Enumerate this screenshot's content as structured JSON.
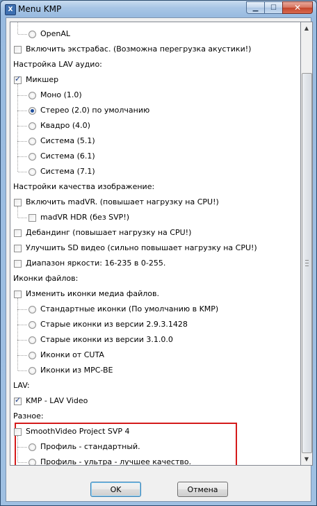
{
  "window": {
    "title": "Menu KMP",
    "icon_glyph": "X"
  },
  "options": [
    {
      "kind": "radio",
      "level": 2,
      "label": "OpenAL",
      "selected": false
    },
    {
      "kind": "checkbox",
      "level": 1,
      "label": "Включить экстрабас. (Возможна перегрузка акустики!)",
      "checked": false
    },
    {
      "kind": "heading",
      "level": 0,
      "label": "Настройка LAV аудио:"
    },
    {
      "kind": "checkbox",
      "level": 1,
      "label": "Микшер",
      "checked": true
    },
    {
      "kind": "radio",
      "level": 2,
      "label": "Моно (1.0)",
      "selected": false
    },
    {
      "kind": "radio",
      "level": 2,
      "label": "Стерео (2.0) по умолчанию",
      "selected": true
    },
    {
      "kind": "radio",
      "level": 2,
      "label": "Квадро (4.0)",
      "selected": false
    },
    {
      "kind": "radio",
      "level": 2,
      "label": "Система (5.1)",
      "selected": false
    },
    {
      "kind": "radio",
      "level": 2,
      "label": "Система (6.1)",
      "selected": false
    },
    {
      "kind": "radio",
      "level": 2,
      "label": "Система (7.1)",
      "selected": false
    },
    {
      "kind": "heading",
      "level": 0,
      "label": "Настройки качества изображение:"
    },
    {
      "kind": "checkbox",
      "level": 1,
      "label": "Включить madVR. (повышает нагрузку на CPU!)",
      "checked": false
    },
    {
      "kind": "checkbox",
      "level": 2,
      "label": "madVR HDR (без SVP!)",
      "checked": false
    },
    {
      "kind": "checkbox",
      "level": 1,
      "label": "Дебандинг (повышает нагрузку на CPU!)",
      "checked": false
    },
    {
      "kind": "checkbox",
      "level": 1,
      "label": "Улучшить SD видео (сильно повышает нагрузку на CPU!)",
      "checked": false
    },
    {
      "kind": "checkbox",
      "level": 1,
      "label": "Диапазон яркости: 16-235 в 0-255.",
      "checked": false
    },
    {
      "kind": "heading",
      "level": 0,
      "label": "Иконки файлов:"
    },
    {
      "kind": "checkbox",
      "level": 1,
      "label": "Изменить иконки медиа файлов.",
      "checked": false
    },
    {
      "kind": "radio",
      "level": 2,
      "label": "Стандартные иконки (По умолчанию в KMP)",
      "selected": false
    },
    {
      "kind": "radio",
      "level": 2,
      "label": "Старые иконки из версии 2.9.3.1428",
      "selected": false
    },
    {
      "kind": "radio",
      "level": 2,
      "label": "Старые иконки из версии 3.1.0.0",
      "selected": false
    },
    {
      "kind": "radio",
      "level": 2,
      "label": "Иконки от CUTA",
      "selected": false
    },
    {
      "kind": "radio",
      "level": 2,
      "label": "Иконки из MPC-BE",
      "selected": false
    },
    {
      "kind": "heading",
      "level": 0,
      "label": "LAV:"
    },
    {
      "kind": "checkbox",
      "level": 1,
      "label": "KMP - LAV Video",
      "checked": true
    },
    {
      "kind": "heading",
      "level": 0,
      "label": "Разное:"
    },
    {
      "kind": "checkbox",
      "level": 1,
      "label": "SmoothVideo Project SVP 4",
      "checked": false
    },
    {
      "kind": "radio",
      "level": 2,
      "label": "Профиль - стандартный.",
      "selected": false
    },
    {
      "kind": "radio",
      "level": 2,
      "label": "Профиль - ультра - лучшее качество.",
      "selected": false
    }
  ],
  "buttons": {
    "ok": "OK",
    "cancel": "Отмена"
  },
  "colors": {
    "highlight_border": "#d41a1a",
    "check_mark": "#1e3f8a",
    "title_bar": "#a9c6e6"
  }
}
